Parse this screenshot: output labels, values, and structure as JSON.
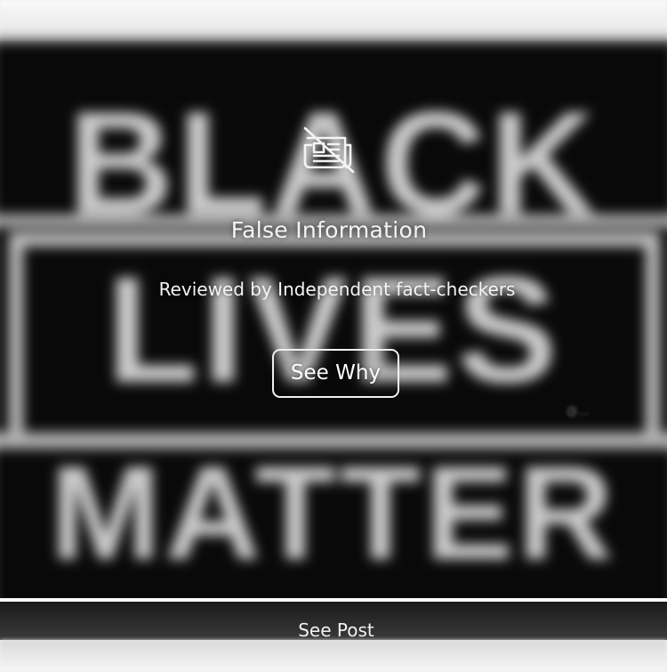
{
  "background_image": {
    "words": [
      "BLACK",
      "LIVES",
      "MATTER"
    ],
    "watermark": "@..."
  },
  "warning": {
    "icon": "news-crossed-out-icon",
    "title": "False Information",
    "subtitle": "Reviewed by Independent fact-checkers",
    "see_why_label": "See Why"
  },
  "footer": {
    "see_post_label": "See Post"
  },
  "colors": {
    "overlay_text": "#f4f4f4",
    "image_background": "#0b0b0b",
    "image_text": "#e8e8e8"
  }
}
